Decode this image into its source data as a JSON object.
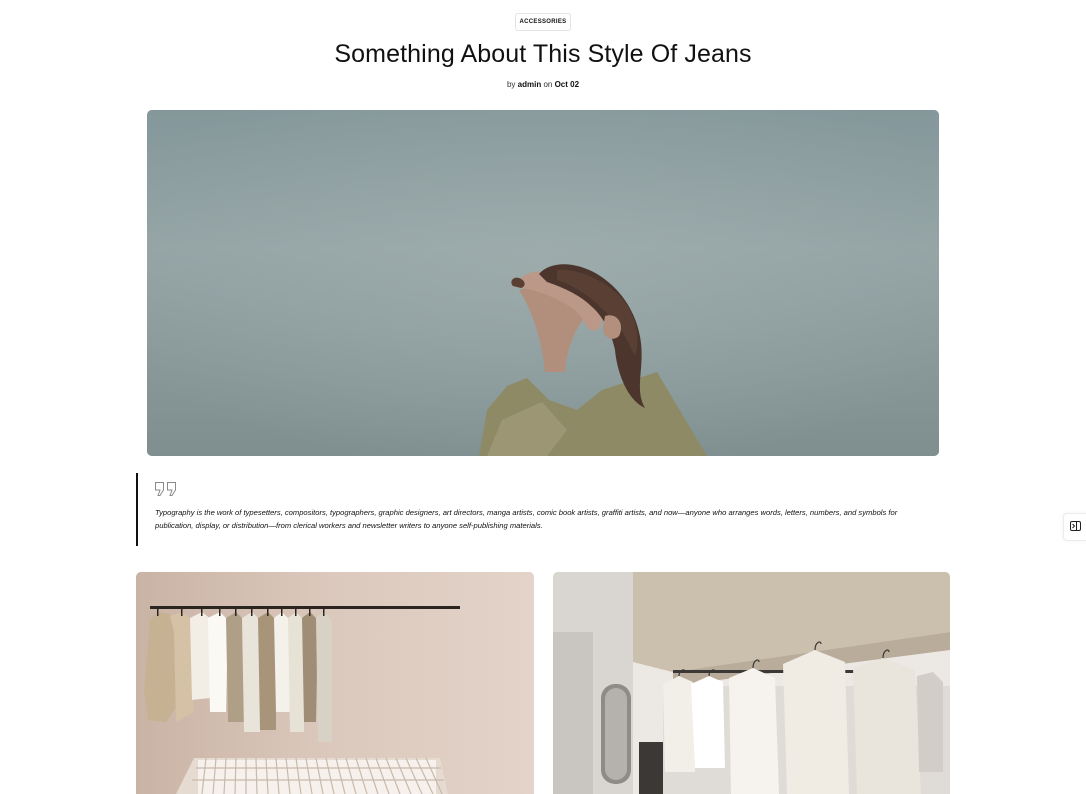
{
  "post": {
    "category": "ACCESSORIES",
    "title": "Something About This Style Of Jeans",
    "meta": {
      "by_label": "by",
      "author": "admin",
      "on_label": "on",
      "date": "Oct 02"
    }
  },
  "quote": {
    "icon": "quote-mark-icon",
    "text": "Typography is the work of typesetters, compositors, typographers, graphic designers, art directors, manga artists, comic book artists, graffiti artists, and now—anyone who arranges words, letters, numbers, and symbols for publication, display, or distribution—from clerical workers and newsletter writers to anyone self-publishing materials."
  },
  "side_tab": {
    "icon": "sidebar-toggle-icon"
  },
  "colors": {
    "text": "#111111",
    "hero_sky": "#8e9e9f",
    "gallery_left_wall": "#dcc9bd",
    "gallery_right_wall": "#ebe7e3"
  }
}
